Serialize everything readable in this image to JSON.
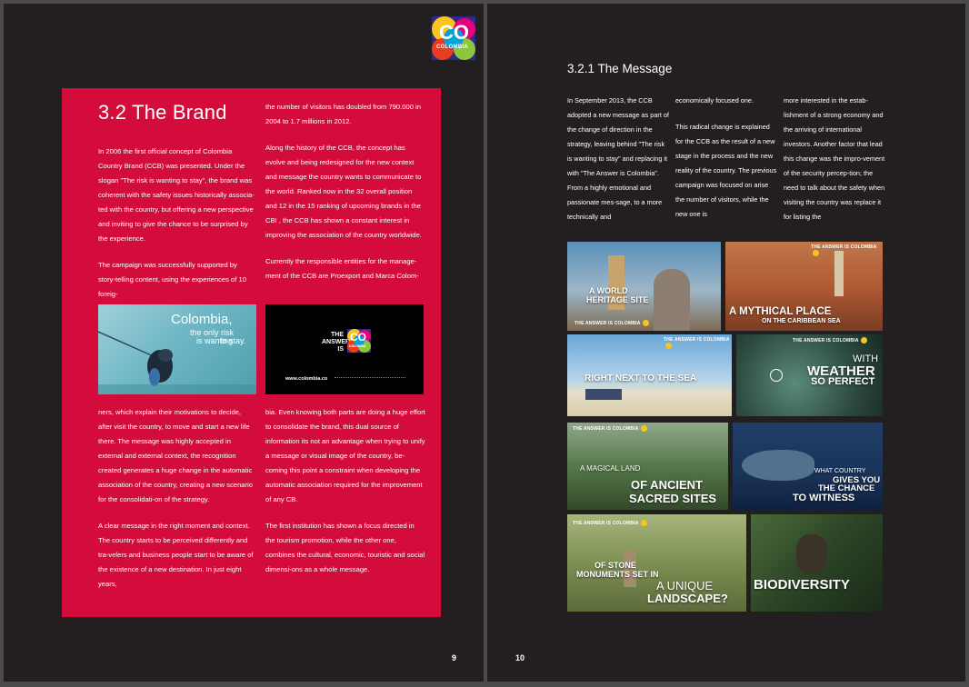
{
  "left_page": {
    "logo": {
      "text": "CO",
      "subtext": "COLOMBIA"
    },
    "heading": "3.2 The Brand",
    "col1_top": [
      "In 2006 the first official concept of Colombia Country Brand (CCB) was presented. Under the slogan \"The risk is wanting to stay\", the brand was coherent with the safety issues historically associa-ted with the country, but offering a new perspective and inviting to give the chance to be surprised by the experience.",
      "The campaign was successfully supported by story-telling content, using the experiences of 10 foreig-"
    ],
    "col2_top": [
      "the number of visitors has doubled from 790.000 in 2004 to 1.7 millions in 2012.",
      "Along the history of the CCB, the concept has evolve and being redesigned for the new context and message the country wants to communicate to the world. Ranked now in the 32 overall position and 12 in the 15 ranking of upcoming brands in the CBI , the CCB has shown a constant interest in improving the association of the country worldwide.",
      "Currently the responsible entities for the manage-ment of the CCB are Proexport and Marca Colom-"
    ],
    "photo1": {
      "title": "Colombia,",
      "line2": "the only risk",
      "line3": "is wanting",
      "line4": "to stay."
    },
    "photo2": {
      "line1": "THE",
      "line2": "ANSWER",
      "line3": "IS",
      "logo": "CO",
      "logo_sub": "COLOMBIA",
      "url": "www.colombia.co"
    },
    "col1_bottom": [
      "ners, which explain their motivations to decide, after visit the country, to move and start a new life there. The message was highly accepted in external and external context, the recognition created generates a huge change in the automatic association of the country, creating a new scenario for the consolidati-on of the strategy.",
      "A clear message in the right moment and context. The country starts to be perceived differently and tra-velers and business people start to be aware of the existence of a new destination. In just eight years,"
    ],
    "col2_bottom": [
      "bia. Even knowing both parts are doing a huge effort to consolidate the brand, this dual source of information its not an advantage when trying to unify a message or visual image of the country, be-coming this point a constraint when developing the automatic association required for the improvement of any CB.",
      "The first institution has shown a focus directed in the tourism promotion, while the other one, combines the cultural, economic, touristic and social dimensi-ons as a whole message."
    ],
    "page_number": "9"
  },
  "right_page": {
    "heading": "3.2.1 The Message",
    "col1": "In September 2013, the CCB adopted a new message as part of the change of direction in the strategy, leaving behind \"The risk is wanting to stay\" and replacing it with \"The Answer is Colombia\". From a highly emotional and passionate mes-sage, to a more technically and",
    "col2_a": "economically focused one.",
    "col2_b": "This radical change is explained for the CCB as the result of a new stage in the process and the new reality of the country. The previous campaign was focused on arise the number of visitors, while the new one is",
    "col3": "more interested in the estab-lishment of a strong economy and the arriving of international investors. Another factor that lead this change was the impro-vement of the security percep-tion; the need to talk about the safety when visiting the country was replace it for listing the",
    "tag": "THE ANSWER IS COLOMBIA",
    "tiles": [
      {
        "caption1": "A WORLD",
        "caption2": "HERITAGE SITE"
      },
      {
        "caption1": "A MYTHICAL PLACE",
        "caption2": "ON THE CARIBBEAN SEA"
      },
      {
        "caption1": "RIGHT NEXT TO THE SEA",
        "caption2": ""
      },
      {
        "caption1": "WITH",
        "caption2": "WEATHER",
        "caption3": "SO PERFECT"
      },
      {
        "caption1": "A MAGICAL LAND",
        "caption2": "OF ANCIENT",
        "caption3": "SACRED SITES"
      },
      {
        "caption1": "WHAT COUNTRY",
        "caption2": "GIVES YOU",
        "caption3": "THE CHANCE",
        "caption4": "TO WITNESS"
      },
      {
        "caption1": "OF STONE",
        "caption2": "MONUMENTS SET IN",
        "caption3": "A UNIQUE",
        "caption4": "LANDSCAPE?"
      },
      {
        "caption1": "BIODIVERSITY"
      }
    ],
    "page_number": "10"
  }
}
